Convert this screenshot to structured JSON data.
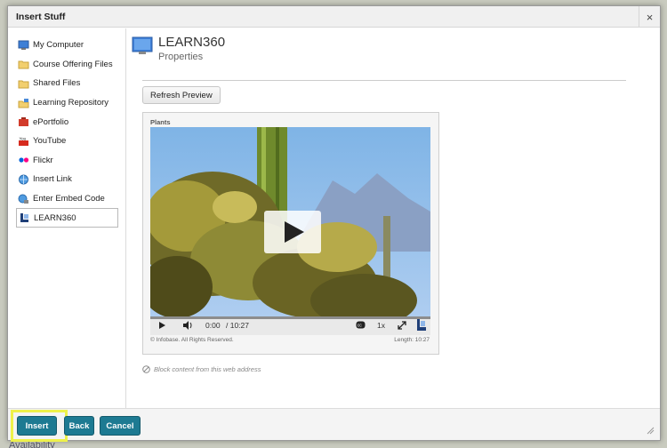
{
  "window": {
    "title": "Insert Stuff",
    "close_glyph": "×"
  },
  "sidebar": {
    "items": [
      {
        "label": "My Computer",
        "icon": "computer-icon"
      },
      {
        "label": "Course Offering Files",
        "icon": "folder-icon"
      },
      {
        "label": "Shared Files",
        "icon": "folder-icon"
      },
      {
        "label": "Learning Repository",
        "icon": "repository-icon"
      },
      {
        "label": "ePortfolio",
        "icon": "eportfolio-icon"
      },
      {
        "label": "YouTube",
        "icon": "youtube-icon"
      },
      {
        "label": "Flickr",
        "icon": "flickr-icon"
      },
      {
        "label": "Insert Link",
        "icon": "link-globe-icon"
      },
      {
        "label": "Enter Embed Code",
        "icon": "embed-icon"
      },
      {
        "label": "LEARN360",
        "icon": "learn360-icon",
        "active": true
      }
    ]
  },
  "provider": {
    "name": "LEARN360",
    "subtitle": "Properties"
  },
  "refresh_label": "Refresh Preview",
  "preview": {
    "title": "Plants",
    "time_current": "0:00",
    "time_total": "/ 10:27",
    "speed": "1x",
    "copyright": "© Infobase. All Rights Reserved.",
    "length": "Length: 10:27",
    "progress": 0
  },
  "block_content": "Block content from this web address",
  "footer": {
    "insert_label": "Insert",
    "back_label": "Back",
    "cancel_label": "Cancel"
  },
  "background": {
    "peek_text": "Availability"
  },
  "colors": {
    "primary_button": "#1d7a92",
    "highlight": "#eef14a"
  }
}
